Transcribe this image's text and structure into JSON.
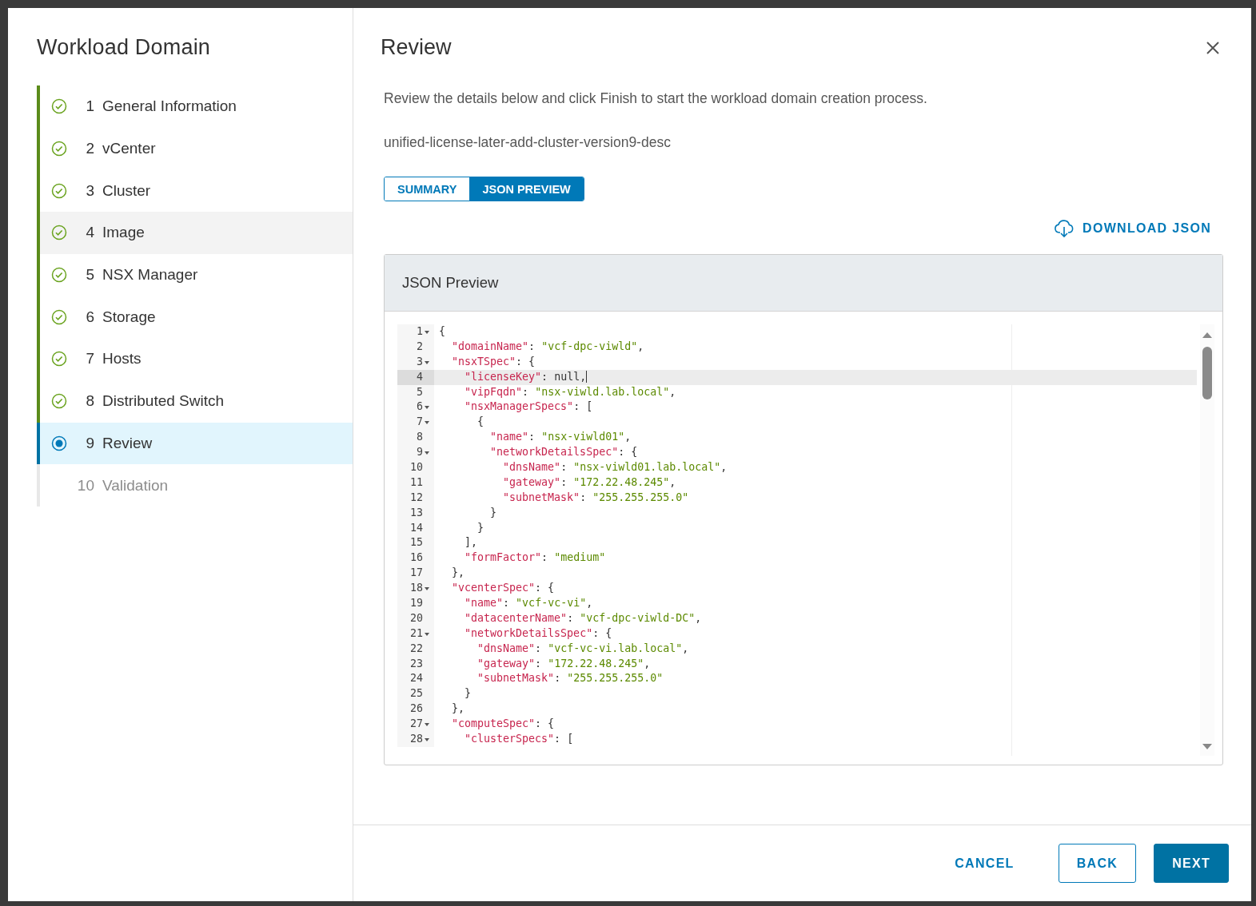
{
  "wizard": {
    "title": "Workload Domain",
    "steps": [
      {
        "number": "1",
        "label": "General Information",
        "completed": true,
        "current": false,
        "hovered": false
      },
      {
        "number": "2",
        "label": "vCenter",
        "completed": true,
        "current": false,
        "hovered": false
      },
      {
        "number": "3",
        "label": "Cluster",
        "completed": true,
        "current": false,
        "hovered": false
      },
      {
        "number": "4",
        "label": "Image",
        "completed": true,
        "current": false,
        "hovered": true
      },
      {
        "number": "5",
        "label": "NSX Manager",
        "completed": true,
        "current": false,
        "hovered": false
      },
      {
        "number": "6",
        "label": "Storage",
        "completed": true,
        "current": false,
        "hovered": false
      },
      {
        "number": "7",
        "label": "Hosts",
        "completed": true,
        "current": false,
        "hovered": false
      },
      {
        "number": "8",
        "label": "Distributed Switch",
        "completed": true,
        "current": false,
        "hovered": false
      },
      {
        "number": "9",
        "label": "Review",
        "completed": false,
        "current": true,
        "hovered": false
      },
      {
        "number": "10",
        "label": "Validation",
        "completed": false,
        "current": false,
        "hovered": false
      }
    ]
  },
  "review": {
    "title": "Review",
    "description": "Review the details below and click Finish to start the workload domain creation process.",
    "spec_name": "unified-license-later-add-cluster-version9-desc",
    "tabs": [
      {
        "label": "SUMMARY",
        "selected": false
      },
      {
        "label": "JSON PREVIEW",
        "selected": true
      }
    ],
    "download_link": "DOWNLOAD JSON",
    "panel_title": "JSON Preview",
    "code_lines": [
      {
        "number": "1",
        "fold": true,
        "current": false,
        "code": "{"
      },
      {
        "number": "2",
        "fold": false,
        "current": false,
        "code": "  \"domainName\": \"vcf-dpc-viwld\","
      },
      {
        "number": "3",
        "fold": true,
        "current": false,
        "code": "  \"nsxTSpec\": {"
      },
      {
        "number": "4",
        "fold": false,
        "current": true,
        "code": "    \"licenseKey\": null,"
      },
      {
        "number": "5",
        "fold": false,
        "current": false,
        "code": "    \"vipFqdn\": \"nsx-viwld.lab.local\","
      },
      {
        "number": "6",
        "fold": true,
        "current": false,
        "code": "    \"nsxManagerSpecs\": ["
      },
      {
        "number": "7",
        "fold": true,
        "current": false,
        "code": "      {"
      },
      {
        "number": "8",
        "fold": false,
        "current": false,
        "code": "        \"name\": \"nsx-viwld01\","
      },
      {
        "number": "9",
        "fold": true,
        "current": false,
        "code": "        \"networkDetailsSpec\": {"
      },
      {
        "number": "10",
        "fold": false,
        "current": false,
        "code": "          \"dnsName\": \"nsx-viwld01.lab.local\","
      },
      {
        "number": "11",
        "fold": false,
        "current": false,
        "code": "          \"gateway\": \"172.22.48.245\","
      },
      {
        "number": "12",
        "fold": false,
        "current": false,
        "code": "          \"subnetMask\": \"255.255.255.0\""
      },
      {
        "number": "13",
        "fold": false,
        "current": false,
        "code": "        }"
      },
      {
        "number": "14",
        "fold": false,
        "current": false,
        "code": "      }"
      },
      {
        "number": "15",
        "fold": false,
        "current": false,
        "code": "    ],"
      },
      {
        "number": "16",
        "fold": false,
        "current": false,
        "code": "    \"formFactor\": \"medium\""
      },
      {
        "number": "17",
        "fold": false,
        "current": false,
        "code": "  },"
      },
      {
        "number": "18",
        "fold": true,
        "current": false,
        "code": "  \"vcenterSpec\": {"
      },
      {
        "number": "19",
        "fold": false,
        "current": false,
        "code": "    \"name\": \"vcf-vc-vi\","
      },
      {
        "number": "20",
        "fold": false,
        "current": false,
        "code": "    \"datacenterName\": \"vcf-dpc-viwld-DC\","
      },
      {
        "number": "21",
        "fold": true,
        "current": false,
        "code": "    \"networkDetailsSpec\": {"
      },
      {
        "number": "22",
        "fold": false,
        "current": false,
        "code": "      \"dnsName\": \"vcf-vc-vi.lab.local\","
      },
      {
        "number": "23",
        "fold": false,
        "current": false,
        "code": "      \"gateway\": \"172.22.48.245\","
      },
      {
        "number": "24",
        "fold": false,
        "current": false,
        "code": "      \"subnetMask\": \"255.255.255.0\""
      },
      {
        "number": "25",
        "fold": false,
        "current": false,
        "code": "    }"
      },
      {
        "number": "26",
        "fold": false,
        "current": false,
        "code": "  },"
      },
      {
        "number": "27",
        "fold": true,
        "current": false,
        "code": "  \"computeSpec\": {"
      },
      {
        "number": "28",
        "fold": true,
        "current": false,
        "code": "    \"clusterSpecs\": ["
      }
    ]
  },
  "footer": {
    "buttons": [
      {
        "label": "CANCEL",
        "kind": "link"
      },
      {
        "label": "BACK",
        "kind": "outline"
      },
      {
        "label": "NEXT",
        "kind": "primary"
      }
    ]
  }
}
